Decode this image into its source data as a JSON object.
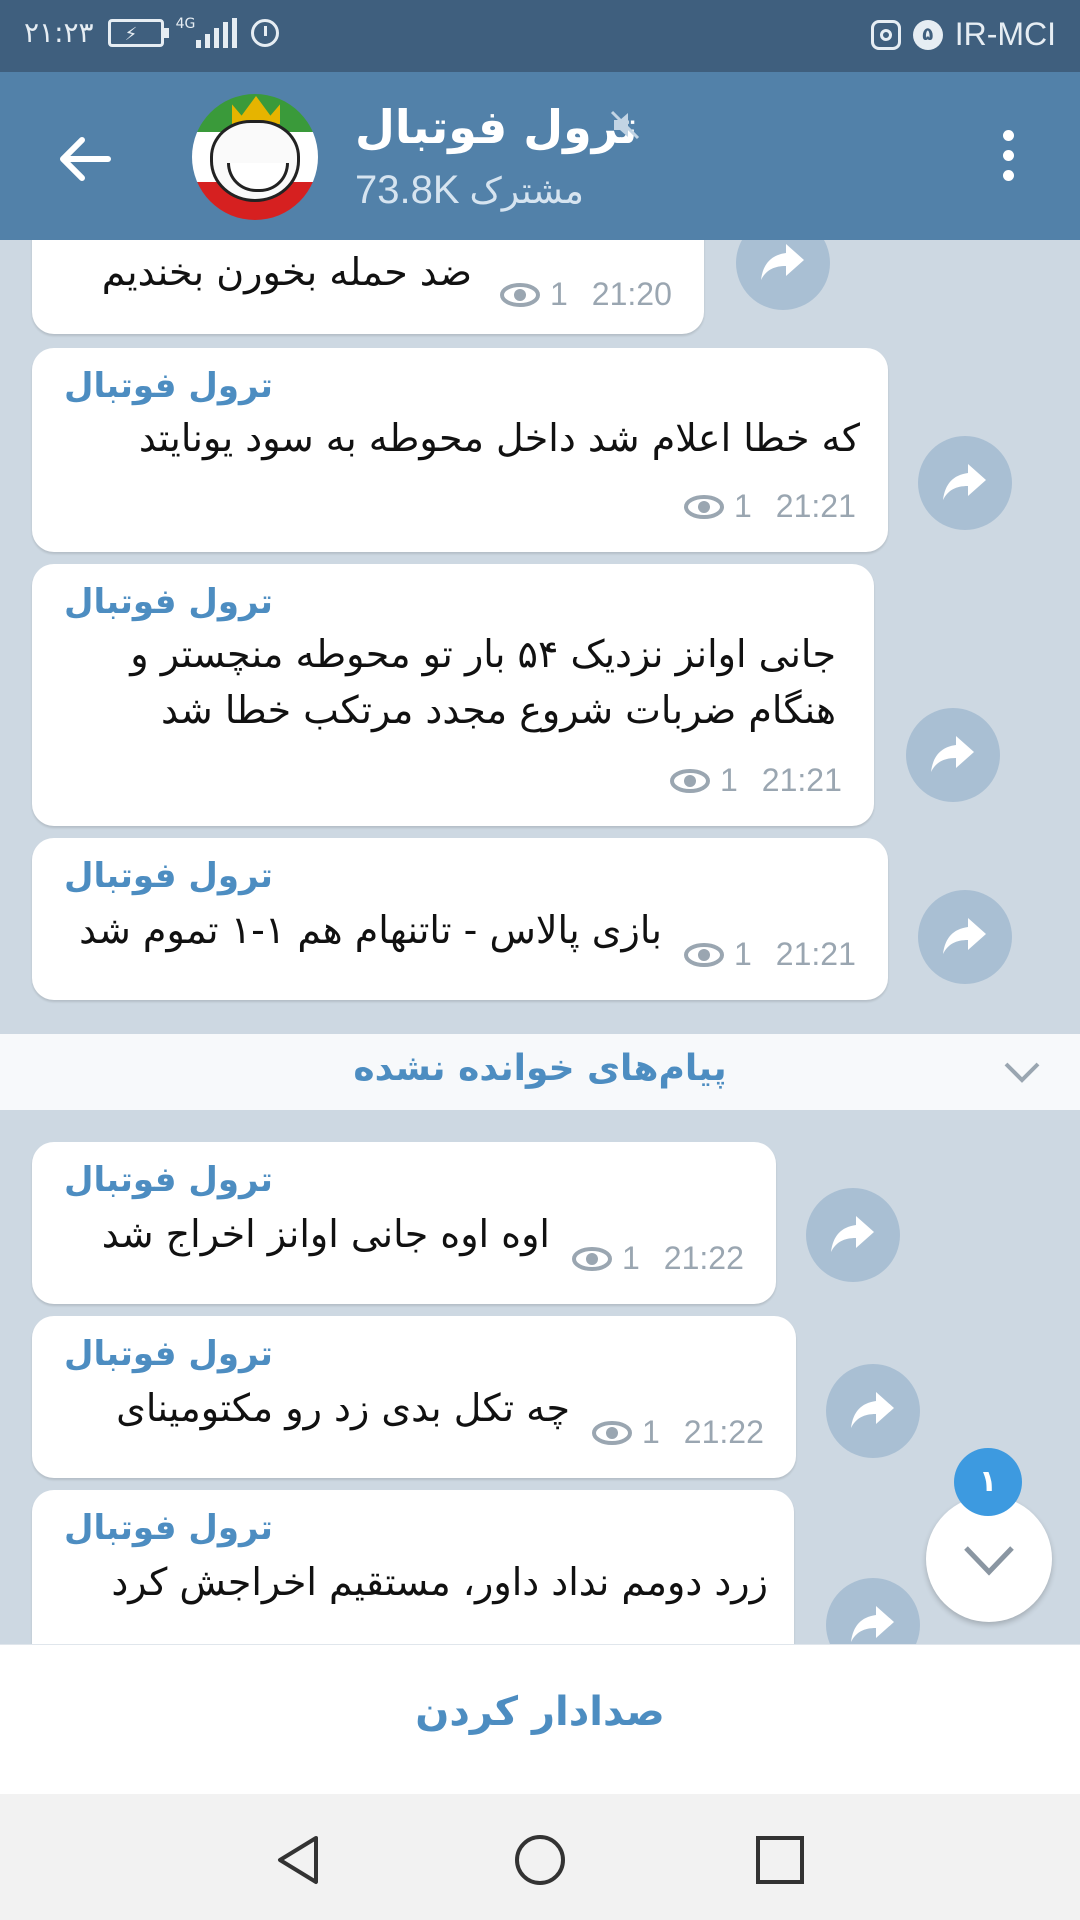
{
  "status_bar": {
    "time": "۲۱:۲۳",
    "network": "4G",
    "notification_count": "۵",
    "carrier": "IR-MCI"
  },
  "header": {
    "title": "ترول فوتبال",
    "subscribers_count": "73.8K",
    "subscribers_label": "مشترک"
  },
  "messages_before": [
    {
      "text": "ضد حمله بخورن بخندیم",
      "views": "1",
      "time": "21:20"
    },
    {
      "sender": "ترول فوتبال",
      "text": "که خطا اعلام شد داخل محوطه به سود یونایتد",
      "views": "1",
      "time": "21:21"
    },
    {
      "sender": "ترول فوتبال",
      "text_line1": "جانی اوانز نزدیک ۵۴ بار تو محوطه منچستر و",
      "text_line2": "هنگام ضربات شروع مجدد مرتکب خطا شد",
      "views": "1",
      "time": "21:21"
    },
    {
      "sender": "ترول فوتبال",
      "text": "بازی پالاس - تاتنهام هم ۱-۱ تموم شد",
      "views": "1",
      "time": "21:21"
    }
  ],
  "unread_divider": "پیام‌های خوانده نشده",
  "messages_after": [
    {
      "sender": "ترول فوتبال",
      "text": "اوه اوه جانی اوانز اخراج شد",
      "views": "1",
      "time": "21:22"
    },
    {
      "sender": "ترول فوتبال",
      "text": "چه تکل بدی زد رو مکتومینای",
      "views": "1",
      "time": "21:22"
    },
    {
      "sender": "ترول فوتبال",
      "text": "زرد دومم نداد داور، مستقیم اخراجش کرد"
    }
  ],
  "scroll_down_badge": "۱",
  "bottom_action": "صدادار کردن",
  "colors": {
    "header": "#5281a9",
    "status_bar": "#3f5f7e",
    "accent": "#4d8dc1",
    "badge": "#3d9ae0"
  }
}
